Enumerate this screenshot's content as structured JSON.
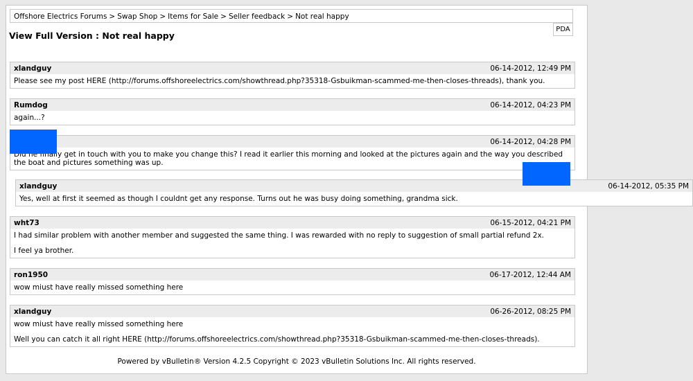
{
  "breadcrumb": {
    "items": [
      "Offshore Electrics Forums",
      "Swap Shop",
      "Items for Sale",
      "Seller feedback",
      "Not real happy"
    ],
    "separator": ">"
  },
  "pda_label": "PDA",
  "page_title": "View Full Version : Not real happy",
  "posts": [
    {
      "author": "xlandguy",
      "date": "06-14-2012, 12:49 PM",
      "lines": [
        "Please see my post HERE (http://forums.offshoreelectrics.com/showthread.php?35318-Gsbuikman-scammed-me-then-closes-threads), thank you."
      ]
    },
    {
      "author": "Rumdog",
      "date": "06-14-2012, 04:23 PM",
      "lines": [
        "again...?"
      ]
    },
    {
      "author": "",
      "date": "06-14-2012, 04:28 PM",
      "lines": [
        "Did he finally get in touch with you to make you change this? I read it earlier this morning and looked at the pictures again and the way you described the boat and pictures something was up."
      ]
    },
    {
      "author": "xlandguy",
      "date": "06-14-2012, 05:35 PM",
      "lines": [
        "Yes, well at first it seemed as though I couldnt get any response. Turns out he was busy doing something, grandma sick."
      ]
    },
    {
      "author": "wht73",
      "date": "06-15-2012, 04:21 PM",
      "lines": [
        "I had similar problem with another member and suggested the same thing. I was rewarded with no reply to suggestion of small partial refund 2x.",
        "I feel ya brother."
      ]
    },
    {
      "author": "ron1950",
      "date": "06-17-2012, 12:44 AM",
      "lines": [
        "wow miust have really missed something here"
      ]
    },
    {
      "author": "xlandguy",
      "date": "06-26-2012, 08:25 PM",
      "lines": [
        "wow miust have really missed something here",
        "Well you can catch it all right HERE (http://forums.offshoreelectrics.com/showthread.php?35318-Gsbuikman-scammed-me-then-closes-threads)."
      ]
    }
  ],
  "footer": "Powered by vBulletin® Version 4.2.5 Copyright © 2023 vBulletin Solutions Inc. All rights reserved.",
  "colors": {
    "redaction": "#0066ff",
    "post_header_bg": "#ececec",
    "border": "#c8c8c8"
  }
}
